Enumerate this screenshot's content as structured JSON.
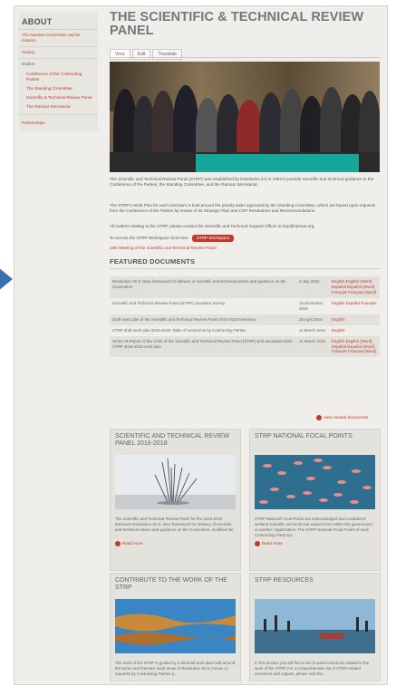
{
  "sidebar": {
    "title": "ABOUT",
    "items": [
      {
        "label": "The Ramsar Convention and its mission"
      },
      {
        "label": "History"
      },
      {
        "label": "Bodies"
      }
    ],
    "subitems": [
      {
        "label": "Conference of the Contracting Parties"
      },
      {
        "label": "The Standing Committee"
      },
      {
        "label": "Scientific & Technical Review Panel"
      },
      {
        "label": "The Ramsar Secretariat"
      }
    ],
    "last_item": "Partnerships"
  },
  "page": {
    "title": "THE SCIENTIFIC & TECHNICAL REVIEW PANEL",
    "tabs": [
      "View",
      "Edit",
      "Translate"
    ],
    "intro": "The Scientific and Technical Review Panel (STRP) was established by Resolution 5.5 in 1993 to provide scientific and technical guidance to the Conference of the Parties, the Standing Committee, and the Ramsar Secretariat.",
    "work_plan": "The STRP's Work Plan for each triennium is built around the priority tasks approved by the Standing Committee, which are based upon requests from the Conference of the Parties by means of its Strategic Plan and COP Resolutions and Recommendations.",
    "contact": "All matters relating to the STRP, please contact the Scientific and Technical Support Officer at strp@ramsar.org.",
    "workspace_prefix": "To access the STRP Workspace click here:",
    "workspace_button": "STRP Workspace",
    "meeting_link": "19th Meeting of the Scientific and Technical Review Panel",
    "featured_heading": "FEATURED DOCUMENTS",
    "view_related": "View related documents"
  },
  "documents": [
    {
      "title": "Resolution XII.5: New framework for delivery of scientific and technical advice and guidance on the Convention",
      "date": "3 July 2015",
      "langs": [
        "English",
        "English (Word)",
        "Español",
        "Español (Word)",
        "Français",
        "Français (Word)"
      ]
    },
    {
      "title": "Scientific and Technical Review Panel (STRP) Literature Survey",
      "date": "15 December 2015",
      "langs": [
        "English",
        "Español",
        "Français"
      ]
    },
    {
      "title": "Draft work plan of the Scientific and Technical Review Panel 2016-2018 triennium",
      "date": "25 April 2016",
      "langs": [
        "English"
      ]
    },
    {
      "title": "STRP draft work plan 2016-2018: Table of comments by Contracting Parties",
      "date": "11 March 2016",
      "langs": [
        "English"
      ]
    },
    {
      "title": "SC52-18 Report of the Chair of the Scientific and Technical Review Panel (STRP) and annotated draft STRP 2016-2018 work plan",
      "date": "11 March 2016",
      "langs": [
        "English",
        "English (Word)",
        "Español",
        "Español (Word)",
        "Français",
        "Français (Word)"
      ]
    }
  ],
  "cards": [
    {
      "title": "SCIENTIFIC AND TECHNICAL REVIEW PANEL 2016-2018",
      "text": "The Scientific and Technical Review Panel for the 2016-2018 triennium Resolution XII.5, New framework for delivery of scientific and technical advice and guidance on the Convention, modified the ...",
      "more": "Read more"
    },
    {
      "title": "STRP NATIONAL FOCAL POINTS",
      "text": "STRP National Focal Points are acknowledged and considered wetland scientific and technical experts from either the government or another organization. The STRP National Focal Points of each Contracting Party act...",
      "more": "Read more"
    },
    {
      "title": "CONTRIBUTE TO THE WORK OF THE STRP",
      "text": "The work of the STRP is guided by a triennial work plan built around the terms and thematic work areas in Resolution XII.5 (Annex 1), requests by Contracting Parties (i...",
      "more": ""
    },
    {
      "title": "STRP RESOURCES",
      "text": "In this section you will find a list of useful resources related to the work of the STRP. For a comprehensive list of STRP-related resources and outputs, please visit the...",
      "more": ""
    }
  ]
}
